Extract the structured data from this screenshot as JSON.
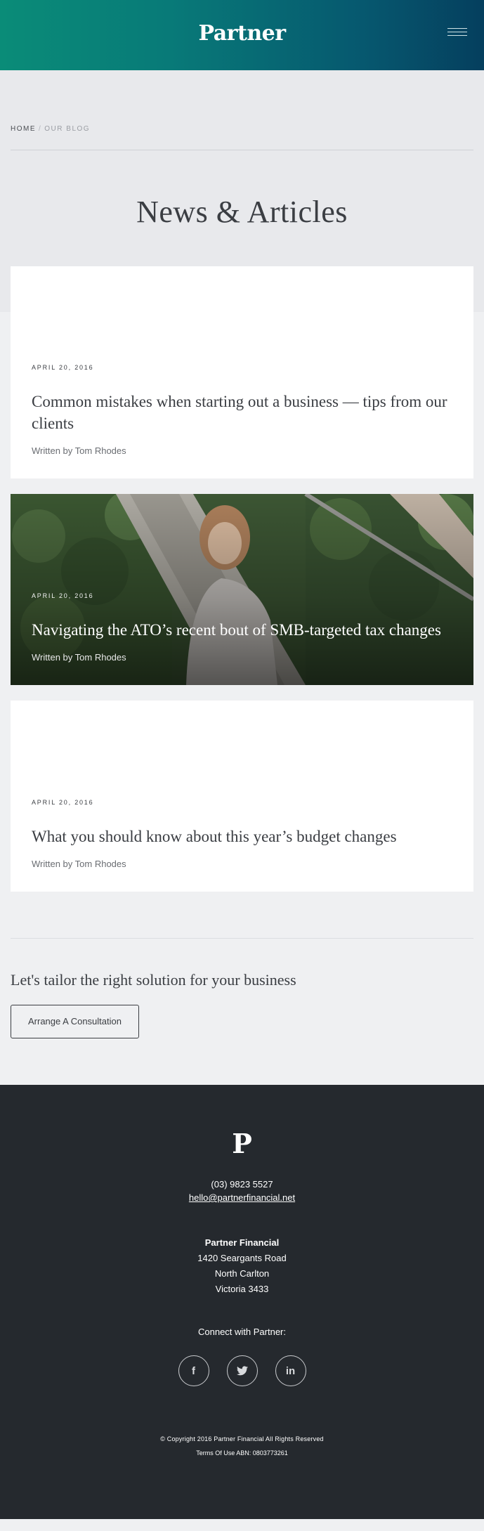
{
  "header": {
    "logo": "Partner",
    "menu_icon": "hamburger-menu-icon"
  },
  "breadcrumb": {
    "home": "Home",
    "separator": "/",
    "current": "Our Blog"
  },
  "hero": {
    "title": "News & Articles"
  },
  "posts": [
    {
      "date": "April 20, 2016",
      "title": "Common mistakes when starting out a business — tips from our clients",
      "author": "Written by Tom Rhodes",
      "has_image": false
    },
    {
      "date": "April 20, 2016",
      "title": "Navigating the ATO’s recent bout of SMB-targeted tax changes",
      "author": "Written by Tom Rhodes",
      "has_image": true
    },
    {
      "date": "April 20, 2016",
      "title": "What you should know about this year’s budget changes",
      "author": "Written by Tom Rhodes",
      "has_image": false
    }
  ],
  "cta": {
    "heading": "Let's tailor the right solution for your business",
    "button": "Arrange A Consultation"
  },
  "footer": {
    "logo": "P",
    "phone": "(03) 9823 5527",
    "email": "hello@partnerfinancial.net",
    "address": {
      "company": "Partner Financial",
      "street": "1420 Seargants Road",
      "suburb": "North Carlton",
      "state": "Victoria 3433"
    },
    "connect": "Connect with Partner:",
    "social": [
      {
        "glyph": "f",
        "icon": "facebook-icon"
      },
      {
        "glyph": "t",
        "icon": "twitter-icon"
      },
      {
        "glyph": "in",
        "icon": "linkedin-icon"
      }
    ],
    "copyright": "© Copyright 2016 Partner Financial All Rights Reserved",
    "terms": "Terms Of Use",
    "abn": "ABN: 0803773261"
  },
  "colors": {
    "header_gradient_start": "#0a8c78",
    "header_gradient_end": "#053f5e",
    "footer_bg": "#25292e",
    "page_bg": "#eff0f2"
  }
}
